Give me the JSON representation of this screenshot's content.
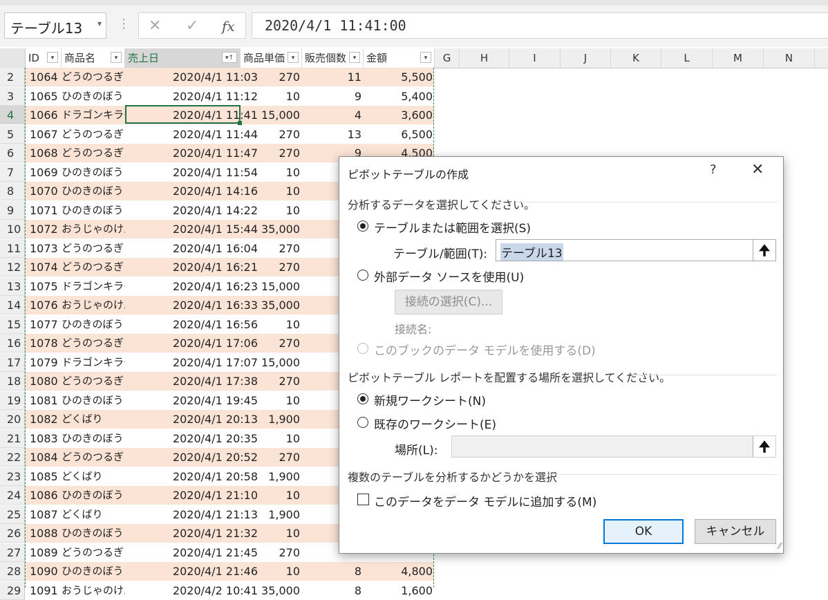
{
  "formula_bar": {
    "name_box": "テーブル13",
    "name_box_arrow": "▾",
    "more_icon": "⋮",
    "cancel_icon": "✕",
    "enter_icon": "✓",
    "fx_icon": "fx",
    "formula": "2020/4/1  11:41:00"
  },
  "columns": {
    "table_headers": [
      "ID",
      "商品名",
      "売上日",
      "商品単価",
      "販売個数",
      "金額"
    ],
    "dropdown_icon": "▾",
    "sort_icon": "▾↑",
    "extra": [
      "G",
      "H",
      "I",
      "J",
      "K",
      "L",
      "M",
      "N"
    ]
  },
  "rows": [
    {
      "n": "2",
      "id": "1064",
      "name": "どうのつるぎ",
      "date": "2020/4/1 11:03",
      "price": "270",
      "qty": "11",
      "amt": "5,500"
    },
    {
      "n": "3",
      "id": "1065",
      "name": "ひのきのぼう",
      "date": "2020/4/1 11:12",
      "price": "10",
      "qty": "9",
      "amt": "5,400"
    },
    {
      "n": "4",
      "id": "1066",
      "name": "ドラゴンキラー",
      "date": "2020/4/1 11:41",
      "price": "15,000",
      "qty": "4",
      "amt": "3,600"
    },
    {
      "n": "5",
      "id": "1067",
      "name": "どうのつるぎ",
      "date": "2020/4/1 11:44",
      "price": "270",
      "qty": "13",
      "amt": "6,500"
    },
    {
      "n": "6",
      "id": "1068",
      "name": "どうのつるぎ",
      "date": "2020/4/1 11:47",
      "price": "270",
      "qty": "9",
      "amt": "4,500"
    },
    {
      "n": "7",
      "id": "1069",
      "name": "ひのきのぼう",
      "date": "2020/4/1 11:54",
      "price": "10",
      "qty": "",
      "amt": ""
    },
    {
      "n": "8",
      "id": "1070",
      "name": "ひのきのぼう",
      "date": "2020/4/1 14:16",
      "price": "10",
      "qty": "",
      "amt": ""
    },
    {
      "n": "9",
      "id": "1071",
      "name": "ひのきのぼう",
      "date": "2020/4/1 14:22",
      "price": "10",
      "qty": "",
      "amt": ""
    },
    {
      "n": "10",
      "id": "1072",
      "name": "おうじゃのけん",
      "date": "2020/4/1 15:44",
      "price": "35,000",
      "qty": "",
      "amt": ""
    },
    {
      "n": "11",
      "id": "1073",
      "name": "どうのつるぎ",
      "date": "2020/4/1 16:04",
      "price": "270",
      "qty": "",
      "amt": ""
    },
    {
      "n": "12",
      "id": "1074",
      "name": "どうのつるぎ",
      "date": "2020/4/1 16:21",
      "price": "270",
      "qty": "",
      "amt": ""
    },
    {
      "n": "13",
      "id": "1075",
      "name": "ドラゴンキラー",
      "date": "2020/4/1 16:23",
      "price": "15,000",
      "qty": "",
      "amt": ""
    },
    {
      "n": "14",
      "id": "1076",
      "name": "おうじゃのけん",
      "date": "2020/4/1 16:33",
      "price": "35,000",
      "qty": "",
      "amt": ""
    },
    {
      "n": "15",
      "id": "1077",
      "name": "ひのきのぼう",
      "date": "2020/4/1 16:56",
      "price": "10",
      "qty": "",
      "amt": ""
    },
    {
      "n": "16",
      "id": "1078",
      "name": "どうのつるぎ",
      "date": "2020/4/1 17:06",
      "price": "270",
      "qty": "",
      "amt": ""
    },
    {
      "n": "17",
      "id": "1079",
      "name": "ドラゴンキラー",
      "date": "2020/4/1 17:07",
      "price": "15,000",
      "qty": "",
      "amt": ""
    },
    {
      "n": "18",
      "id": "1080",
      "name": "どうのつるぎ",
      "date": "2020/4/1 17:38",
      "price": "270",
      "qty": "",
      "amt": ""
    },
    {
      "n": "19",
      "id": "1081",
      "name": "ひのきのぼう",
      "date": "2020/4/1 19:45",
      "price": "10",
      "qty": "",
      "amt": ""
    },
    {
      "n": "20",
      "id": "1082",
      "name": "どくばり",
      "date": "2020/4/1 20:13",
      "price": "1,900",
      "qty": "",
      "amt": ""
    },
    {
      "n": "21",
      "id": "1083",
      "name": "ひのきのぼう",
      "date": "2020/4/1 20:35",
      "price": "10",
      "qty": "",
      "amt": ""
    },
    {
      "n": "22",
      "id": "1084",
      "name": "どうのつるぎ",
      "date": "2020/4/1 20:52",
      "price": "270",
      "qty": "",
      "amt": ""
    },
    {
      "n": "23",
      "id": "1085",
      "name": "どくばり",
      "date": "2020/4/1 20:58",
      "price": "1,900",
      "qty": "",
      "amt": ""
    },
    {
      "n": "24",
      "id": "1086",
      "name": "ひのきのぼう",
      "date": "2020/4/1 21:10",
      "price": "10",
      "qty": "",
      "amt": ""
    },
    {
      "n": "25",
      "id": "1087",
      "name": "どくばり",
      "date": "2020/4/1 21:13",
      "price": "1,900",
      "qty": "",
      "amt": ""
    },
    {
      "n": "26",
      "id": "1088",
      "name": "ひのきのぼう",
      "date": "2020/4/1 21:32",
      "price": "10",
      "qty": "",
      "amt": ""
    },
    {
      "n": "27",
      "id": "1089",
      "name": "どうのつるぎ",
      "date": "2020/4/1 21:45",
      "price": "270",
      "qty": "",
      "amt": ""
    },
    {
      "n": "28",
      "id": "1090",
      "name": "ひのきのぼう",
      "date": "2020/4/1 21:46",
      "price": "10",
      "qty": "8",
      "amt": "4,800"
    },
    {
      "n": "29",
      "id": "1091",
      "name": "おうじゃのけん",
      "date": "2020/4/2 10:41",
      "price": "35,000",
      "qty": "8",
      "amt": "1,600"
    }
  ],
  "dialog": {
    "title": "ピボットテーブルの作成",
    "help": "?",
    "close": "✕",
    "section1": "分析するデータを選択してください。",
    "opt_range": "テーブルまたは範囲を選択(S)",
    "range_label": "テーブル/範囲(T):",
    "range_value": "テーブル13",
    "range_picker_icon": "🠉",
    "opt_external": "外部データ ソースを使用(U)",
    "connection_button": "接続の選択(C)...",
    "connection_name_label": "接続名:",
    "opt_datamodel": "このブックのデータ モデルを使用する(D)",
    "section2": "ピボットテーブル レポートを配置する場所を選択してください。",
    "opt_new_sheet": "新規ワークシート(N)",
    "opt_existing_sheet": "既存のワークシート(E)",
    "location_label": "場所(L):",
    "location_value": "",
    "section3": "複数のテーブルを分析するかどうかを選択",
    "add_model_label": "このデータをデータ モデルに追加する(M)",
    "ok": "OK",
    "cancel": "キャンセル",
    "grip": "⁄⁄"
  }
}
